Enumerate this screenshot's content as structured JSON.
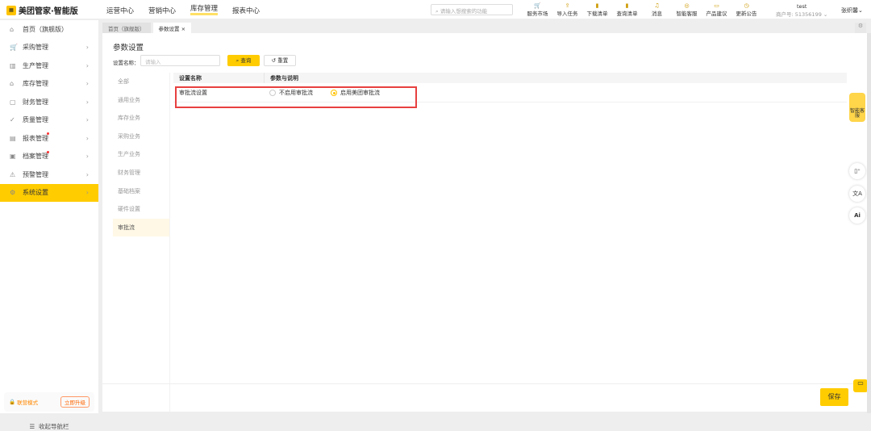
{
  "header": {
    "logo": "美团管家·智能版",
    "nav": [
      "运营中心",
      "营销中心",
      "库存管理",
      "报表中心"
    ],
    "nav_active": 2,
    "search_placeholder": "请输入想搜索的功能",
    "tools": [
      {
        "label": "服务市场",
        "icon": "cart-icon"
      },
      {
        "label": "导入任务",
        "icon": "import-icon"
      },
      {
        "label": "下载清单",
        "icon": "download-icon"
      },
      {
        "label": "查询清单",
        "icon": "query-icon"
      },
      {
        "label": "消息",
        "icon": "bell-icon"
      },
      {
        "label": "智能客服",
        "icon": "service-icon"
      },
      {
        "label": "产品建议",
        "icon": "feedback-icon"
      },
      {
        "label": "更新公告",
        "icon": "notice-icon"
      }
    ],
    "account_name": "test",
    "account_id": "商户号: 51356199",
    "user": "张织馨"
  },
  "sidebar": {
    "items": [
      {
        "label": "首页（旗舰版）",
        "icon": "home-icon"
      },
      {
        "label": "采购管理",
        "icon": "cart-icon"
      },
      {
        "label": "生产管理",
        "icon": "factory-icon"
      },
      {
        "label": "库存管理",
        "icon": "warehouse-icon"
      },
      {
        "label": "财务管理",
        "icon": "wallet-icon"
      },
      {
        "label": "质量管理",
        "icon": "check-icon"
      },
      {
        "label": "报表管理",
        "icon": "report-icon",
        "dot": true
      },
      {
        "label": "档案管理",
        "icon": "archive-icon",
        "dot": true
      },
      {
        "label": "预警管理",
        "icon": "alert-icon"
      },
      {
        "label": "系统设置",
        "icon": "gear-icon",
        "active": true
      }
    ],
    "promo_label": "联营模式",
    "promo_button": "立即升级",
    "collapse_label": "收起导航栏"
  },
  "tabs": [
    {
      "label": "首页（旗舰版）"
    },
    {
      "label": "参数设置",
      "closable": true
    }
  ],
  "main": {
    "title": "参数设置",
    "filter_label": "设置名称：",
    "filter_placeholder": "请输入",
    "query_button": "查询",
    "reset_button": "重置",
    "categories": [
      "全部",
      "通用业务",
      "库存业务",
      "采购业务",
      "生产业务",
      "财务管理",
      "基础档案",
      "硬件设置",
      "审批流"
    ],
    "active_category": 8,
    "table": {
      "headers": [
        "设置名称",
        "参数与说明"
      ],
      "rows": [
        {
          "name": "审批流设置",
          "options": [
            "不启用审批流",
            "启用美团审批流"
          ],
          "selected": 1
        }
      ]
    },
    "save_button": "保存"
  },
  "right_rail": {
    "mascot_label": "智能客服",
    "icons": [
      "panel-icon",
      "translate-icon",
      "ai-icon"
    ]
  },
  "colors": {
    "accent": "#ffcc00",
    "highlight_border": "#e84040"
  }
}
